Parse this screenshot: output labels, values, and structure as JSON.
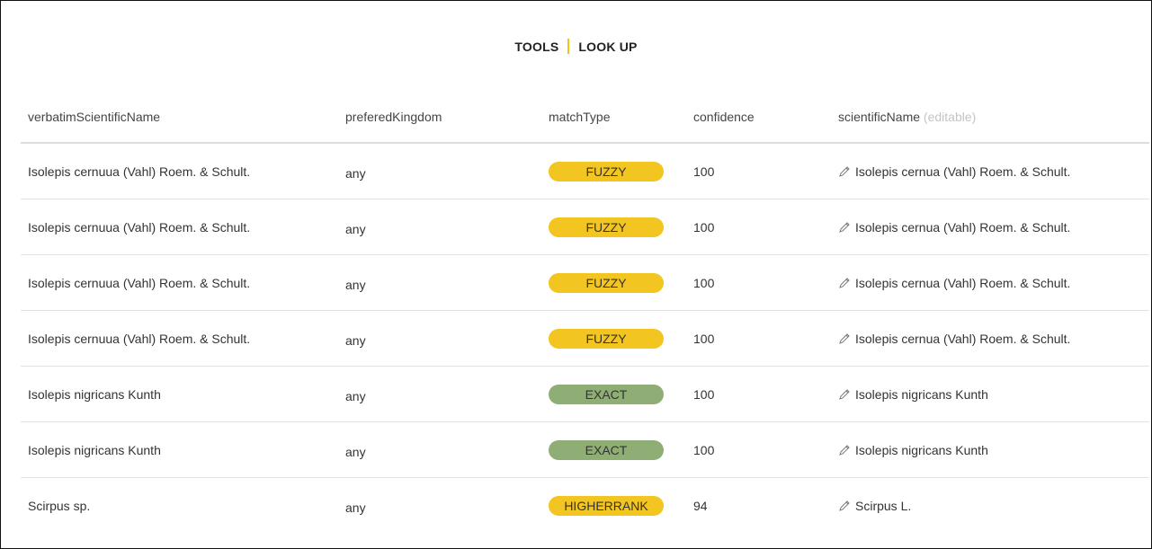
{
  "nav": {
    "tools": "TOOLS",
    "lookup": "LOOK UP"
  },
  "table": {
    "headers": {
      "verbatim": "verbatimScientificName",
      "kingdom": "preferedKingdom",
      "match": "matchType",
      "confidence": "confidence",
      "scientific": "scientificName",
      "scientific_hint": "(editable)"
    },
    "rows": [
      {
        "verbatim": "Isolepis cernuua (Vahl) Roem. & Schult.",
        "kingdom": "any",
        "match": "FUZZY",
        "confidence": "100",
        "scientific": "Isolepis cernua (Vahl) Roem. & Schult."
      },
      {
        "verbatim": "Isolepis cernuua (Vahl) Roem. & Schult.",
        "kingdom": "any",
        "match": "FUZZY",
        "confidence": "100",
        "scientific": "Isolepis cernua (Vahl) Roem. & Schult."
      },
      {
        "verbatim": "Isolepis cernuua (Vahl) Roem. & Schult.",
        "kingdom": "any",
        "match": "FUZZY",
        "confidence": "100",
        "scientific": "Isolepis cernua (Vahl) Roem. & Schult."
      },
      {
        "verbatim": "Isolepis cernuua (Vahl) Roem. & Schult.",
        "kingdom": "any",
        "match": "FUZZY",
        "confidence": "100",
        "scientific": "Isolepis cernua (Vahl) Roem. & Schult."
      },
      {
        "verbatim": "Isolepis nigricans Kunth",
        "kingdom": "any",
        "match": "EXACT",
        "confidence": "100",
        "scientific": "Isolepis nigricans Kunth"
      },
      {
        "verbatim": "Isolepis nigricans Kunth",
        "kingdom": "any",
        "match": "EXACT",
        "confidence": "100",
        "scientific": "Isolepis nigricans Kunth"
      },
      {
        "verbatim": "Scirpus sp.",
        "kingdom": "any",
        "match": "HIGHERRANK",
        "confidence": "94",
        "scientific": "Scirpus L."
      }
    ]
  },
  "colors": {
    "fuzzy": "#f2c520",
    "exact": "#8fae75",
    "higherrank": "#f2c520",
    "accent": "#f0c419"
  },
  "icons": {
    "edit": "pencil-icon"
  }
}
